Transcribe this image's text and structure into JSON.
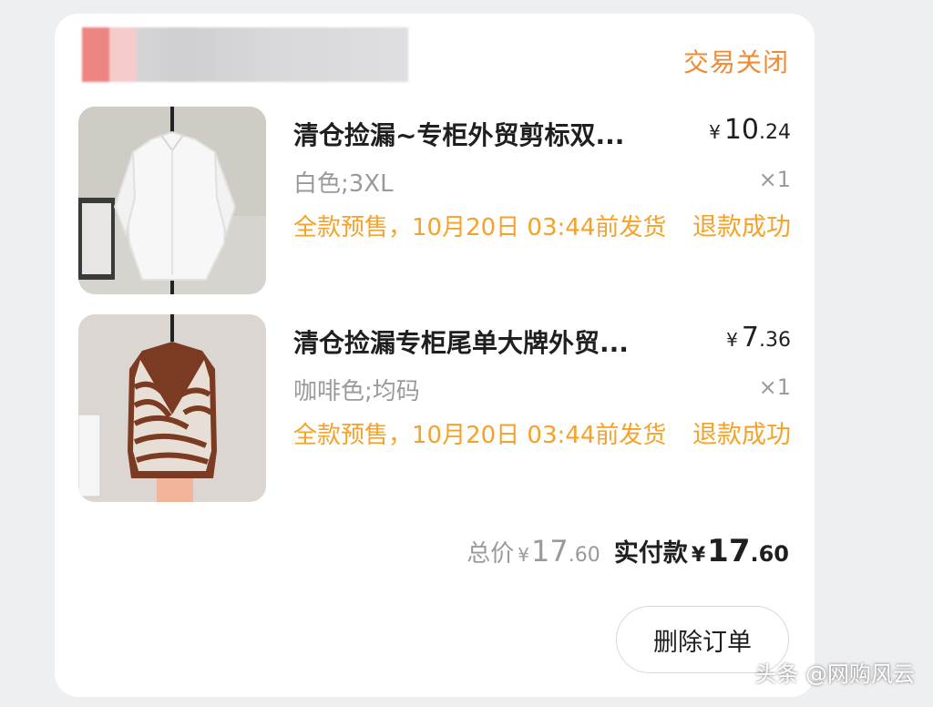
{
  "order": {
    "status": "交易关闭",
    "items": [
      {
        "title": "清仓捡漏~专柜外贸剪标双...",
        "price_currency": "¥",
        "price_int": "10",
        "price_dec": ".24",
        "sku": "白色;3XL",
        "qty": "×1",
        "presale": "全款预售，10月20日 03:44前发货",
        "refund_status": "退款成功",
        "image_icon": "shirt-photo"
      },
      {
        "title": "清仓捡漏专柜尾单大牌外贸...",
        "price_currency": "¥",
        "price_int": "7",
        "price_dec": ".36",
        "sku": "咖啡色;均码",
        "qty": "×1",
        "presale": "全款预售，10月20日 03:44前发货",
        "refund_status": "退款成功",
        "image_icon": "vest-photo"
      }
    ],
    "total_label": "总价",
    "total_currency": "¥",
    "total_int": "17",
    "total_dec": ".60",
    "paid_label": "实付款",
    "paid_currency": "¥",
    "paid_int": "17",
    "paid_dec": ".60",
    "delete_button": "删除订单"
  },
  "watermark": "头条 @网购风云",
  "colors": {
    "status": "#f08a33",
    "presale": "#f4a22a",
    "text": "#1f1f1f",
    "muted": "#9a9a9a"
  }
}
